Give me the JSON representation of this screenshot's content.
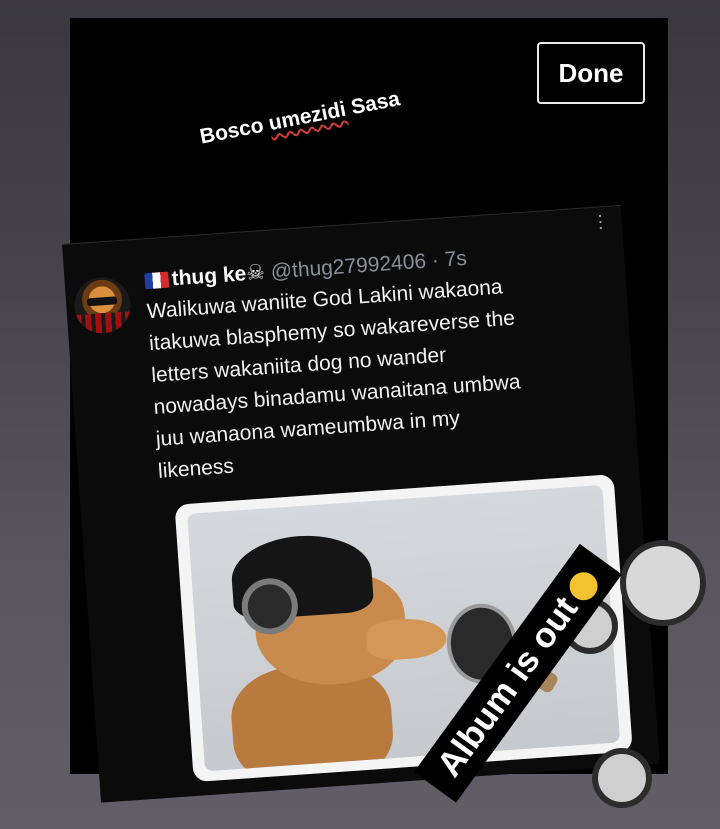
{
  "story": {
    "done_label": "Done",
    "caption_part1": "Bosco ",
    "caption_part2": "umezidi",
    "caption_part3": " Sasa",
    "sticker_text": "Album is out",
    "sticker_emoji": "laughing-emoji-icon"
  },
  "tweet": {
    "display_name": "thug ke",
    "handle": "@thug27992406",
    "separator": " · ",
    "time": "7s",
    "more_icon": "more-vertical-icon",
    "body": "Walikuwa waniite God Lakini wakaona\nitakuwa blasphemy so wakareverse the\nletters wakaniita dog no wander\nnowadays binadamu wanaitana umbwa\njuu wanaona wameumbwa in my\nlikeness",
    "media_description_icon": "singing-dog-image"
  },
  "colors": {
    "background": "#000000",
    "text": "#ffffff",
    "handle": "#8a8f95",
    "caption_underline": "#d23b3b"
  }
}
